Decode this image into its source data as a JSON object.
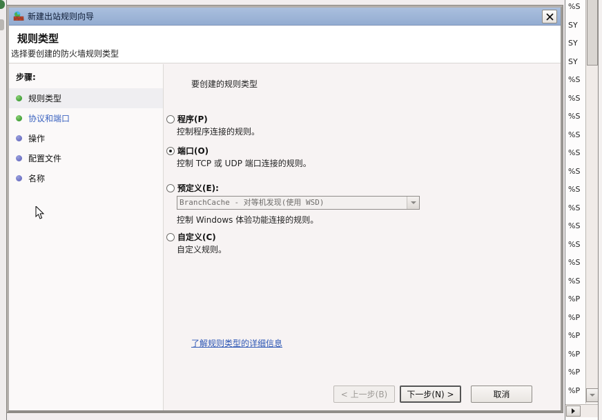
{
  "window": {
    "title": "新建出站规则向导"
  },
  "header": {
    "title": "规则类型",
    "subtitle": "选择要创建的防火墙规则类型"
  },
  "steps": {
    "heading": "步骤:",
    "items": [
      {
        "label": "规则类型",
        "state": "current"
      },
      {
        "label": "协议和端口",
        "state": "done link"
      },
      {
        "label": "操作",
        "state": ""
      },
      {
        "label": "配置文件",
        "state": ""
      },
      {
        "label": "名称",
        "state": ""
      }
    ]
  },
  "main": {
    "prompt": "要创建的规则类型",
    "options": [
      {
        "label": "程序(P)",
        "desc": "控制程序连接的规则。",
        "selected": false
      },
      {
        "label": "端口(O)",
        "desc": "控制 TCP 或 UDP 端口连接的规则。",
        "selected": true
      },
      {
        "label": "预定义(E):",
        "desc": "控制 Windows 体验功能连接的规则。",
        "selected": false,
        "dropdown_value": "BranchCache - 对等机发现(使用 WSD)"
      },
      {
        "label": "自定义(C)",
        "desc": "自定义规则。",
        "selected": false
      }
    ],
    "link": "了解规则类型的详细信息"
  },
  "buttons": {
    "back": "< 上一步(B)",
    "next": "下一步(N) >",
    "cancel": "取消"
  },
  "background_list": {
    "rows": [
      "%S",
      "SY",
      "SY",
      "SY",
      "%S",
      "%S",
      "%S",
      "%S",
      "%S",
      "%S",
      "%S",
      "%S",
      "%S",
      "%S",
      "%S",
      "%S",
      "%P",
      "%P",
      "%P",
      "%P",
      "%P",
      "%P"
    ]
  },
  "colors": {
    "titlebar": "#9db5d6",
    "step_done_bullet": "#3f9e37",
    "step_pending_bullet": "#6b70c2",
    "link": "#2d57b5"
  }
}
